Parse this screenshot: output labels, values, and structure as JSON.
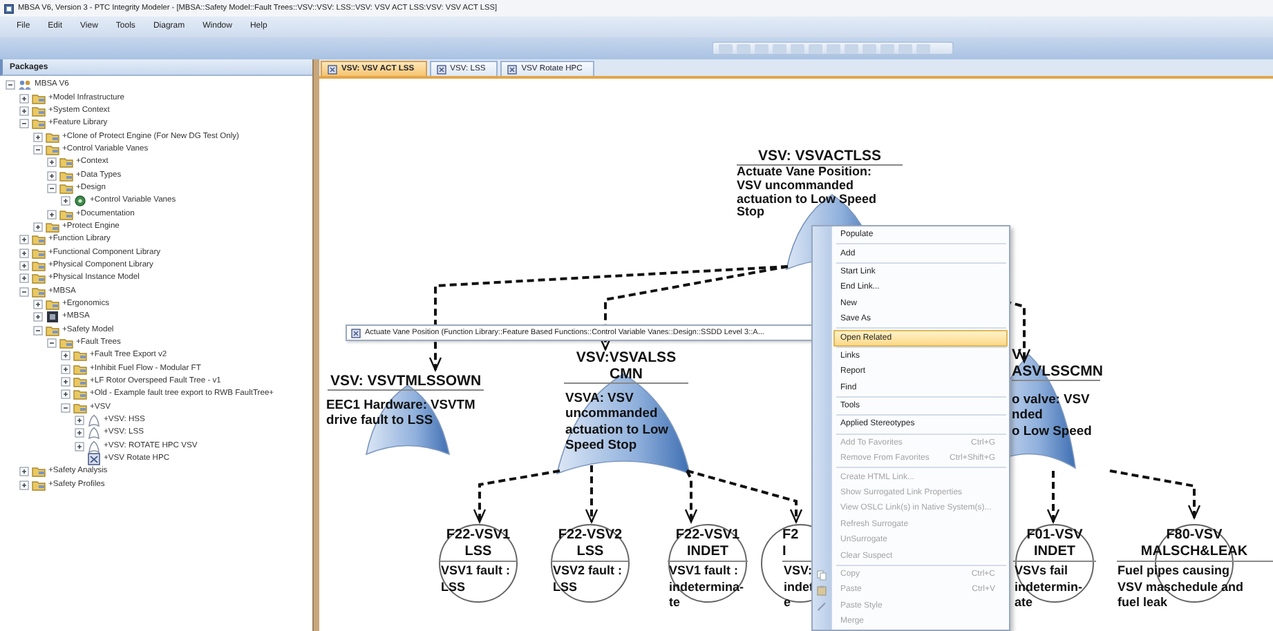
{
  "window": {
    "title": "MBSA V6, Version 3 - PTC Integrity Modeler - [MBSA::Safety Model::Fault Trees::VSV::VSV: LSS::VSV: VSV ACT LSS:VSV: VSV ACT LSS]"
  },
  "menu_bar": [
    "File",
    "Edit",
    "View",
    "Tools",
    "Diagram",
    "Window",
    "Help"
  ],
  "packages": {
    "title": "Packages",
    "tree": [
      {
        "label": "MBSA V6",
        "kind": "model",
        "expanded": true,
        "children": [
          {
            "label": "+Model Infrastructure",
            "kind": "package",
            "expanded": false
          },
          {
            "label": "+System Context",
            "kind": "package",
            "expanded": false
          },
          {
            "label": "+Feature Library",
            "kind": "package",
            "expanded": true,
            "children": [
              {
                "label": "+Clone of Protect Engine (For New DG Test Only)",
                "kind": "package",
                "expanded": false
              },
              {
                "label": "+Control Variable Vanes",
                "kind": "package",
                "expanded": true,
                "children": [
                  {
                    "label": "+Context",
                    "kind": "package",
                    "expanded": false
                  },
                  {
                    "label": "+Data Types",
                    "kind": "package",
                    "expanded": false
                  },
                  {
                    "label": "+Design",
                    "kind": "package",
                    "expanded": true,
                    "children": [
                      {
                        "label": "+Control Variable Vanes",
                        "kind": "component",
                        "expanded": false
                      }
                    ]
                  },
                  {
                    "label": "+Documentation",
                    "kind": "package",
                    "expanded": false
                  }
                ]
              },
              {
                "label": "+Protect Engine",
                "kind": "package",
                "expanded": false
              }
            ]
          },
          {
            "label": "+Function Library",
            "kind": "package",
            "expanded": false
          },
          {
            "label": "+Functional Component Library",
            "kind": "package",
            "expanded": false
          },
          {
            "label": "+Physical Component Library",
            "kind": "package",
            "expanded": false
          },
          {
            "label": "+Physical Instance Model",
            "kind": "package",
            "expanded": false
          },
          {
            "label": "+MBSA",
            "kind": "package",
            "expanded": true,
            "children": [
              {
                "label": "+Ergonomics",
                "kind": "package",
                "expanded": false
              },
              {
                "label": "+MBSA",
                "kind": "block",
                "expanded": false
              },
              {
                "label": "+Safety Model",
                "kind": "package",
                "expanded": true,
                "children": [
                  {
                    "label": "+Fault Trees",
                    "kind": "package",
                    "expanded": true,
                    "children": [
                      {
                        "label": "+Fault Tree Export v2",
                        "kind": "package",
                        "expanded": false
                      },
                      {
                        "label": "+Inhibit Fuel Flow - Modular FT",
                        "kind": "package",
                        "expanded": false
                      },
                      {
                        "label": "+LF Rotor Overspeed Fault Tree - v1",
                        "kind": "package",
                        "expanded": false
                      },
                      {
                        "label": "+Old - Example fault tree export to RWB FaultTree+",
                        "kind": "package",
                        "expanded": false
                      },
                      {
                        "label": "+VSV",
                        "kind": "package",
                        "expanded": true,
                        "children": [
                          {
                            "label": "+VSV: HSS",
                            "kind": "fault-tree",
                            "expanded": false
                          },
                          {
                            "label": "+VSV: LSS",
                            "kind": "fault-tree",
                            "expanded": false
                          },
                          {
                            "label": "+VSV: ROTATE HPC VSV",
                            "kind": "fault-tree",
                            "expanded": false
                          },
                          {
                            "label": "+VSV Rotate HPC",
                            "kind": "diagram"
                          }
                        ]
                      }
                    ]
                  }
                ]
              }
            ]
          },
          {
            "label": "+Safety Analysis",
            "kind": "package",
            "expanded": false
          },
          {
            "label": "+Safety Profiles",
            "kind": "package",
            "expanded": false
          }
        ]
      }
    ]
  },
  "tabs": [
    {
      "label": "VSV: VSV ACT LSS",
      "selected": true
    },
    {
      "label": "VSV: LSS",
      "selected": false
    },
    {
      "label": "VSV Rotate HPC",
      "selected": false
    }
  ],
  "diagram": {
    "gates": [
      {
        "title_lines": [
          "VSV: VSVACTLSS"
        ],
        "description_lines": [
          "Actuate Vane Position:",
          "VSV uncommanded",
          "actuation to Low Speed",
          "Stop"
        ]
      },
      {
        "title_lines": [
          "VSV: VSVTMLSSOWN"
        ],
        "description_lines": [
          "EEC1 Hardware: VSVTM",
          "drive fault to LSS"
        ]
      },
      {
        "title_lines": [
          "VSV:VSVALSS",
          "CMN"
        ],
        "description_lines": [
          "VSVA: VSV",
          "uncommanded",
          "actuation to Low",
          "Speed Stop"
        ]
      },
      {
        "title_lines": [
          "V",
          "ASVLSSCMN"
        ],
        "description_lines": [
          "o valve: VSV",
          "nded",
          "o Low Speed"
        ]
      }
    ],
    "events": [
      {
        "title_lines": [
          "F22-VSV1",
          "LSS"
        ],
        "description_lines": [
          "VSV1 fault :",
          "LSS"
        ]
      },
      {
        "title_lines": [
          "F22-VSV2",
          "LSS"
        ],
        "description_lines": [
          "VSV2 fault :",
          "LSS"
        ]
      },
      {
        "title_lines": [
          "F22-VSV1",
          "INDET"
        ],
        "description_lines": [
          "VSV1 fault :",
          "indetermina-",
          "te"
        ]
      },
      {
        "title_lines": [
          "F2",
          "I"
        ],
        "description_lines": [
          "VSV:",
          "indet",
          "e"
        ]
      },
      {
        "title_lines": [
          "F01-VSV",
          "INDET"
        ],
        "description_lines": [
          "VSVs fail",
          "indetermin-",
          "ate"
        ]
      },
      {
        "title_lines": [
          "F80-VSV",
          "MALSCH&LEAK"
        ],
        "description_lines": [
          "Fuel pipes causing",
          "VSV maschedule and",
          "fuel leak"
        ]
      }
    ],
    "tooltip": "Actuate Vane Position (Function Library::Feature Based Functions::Control Variable Vanes::Design::SSDD Level 3::A..."
  },
  "context_menu": {
    "groups": [
      [
        {
          "label": "Populate",
          "disabled": false,
          "selected": false
        }
      ],
      [
        {
          "label": "Add",
          "disabled": false,
          "selected": false
        }
      ],
      [
        {
          "label": "Start Link",
          "disabled": false,
          "selected": false
        },
        {
          "label": "End Link...",
          "disabled": false,
          "selected": false
        },
        {
          "label": "New",
          "disabled": false,
          "selected": false
        },
        {
          "label": "Save As",
          "disabled": false,
          "selected": false
        }
      ],
      [
        {
          "label": "Open Related",
          "disabled": false,
          "selected": true
        }
      ],
      [
        {
          "label": "Links",
          "disabled": false,
          "selected": false
        },
        {
          "label": "Report",
          "disabled": false,
          "selected": false
        },
        {
          "label": "Find",
          "disabled": false,
          "selected": false
        }
      ],
      [
        {
          "label": "Tools",
          "disabled": false,
          "selected": false
        }
      ],
      [
        {
          "label": "Applied Stereotypes",
          "disabled": false,
          "selected": false
        }
      ],
      [
        {
          "label": "Add To Favorites",
          "shortcut": "Ctrl+G",
          "disabled": true,
          "selected": false
        },
        {
          "label": "Remove From Favorites",
          "shortcut": "Ctrl+Shift+G",
          "disabled": true,
          "selected": false
        }
      ],
      [
        {
          "label": "Create HTML Link...",
          "disabled": true,
          "selected": false
        },
        {
          "label": "Show Surrogated Link Properties",
          "disabled": true,
          "selected": false
        },
        {
          "label": "View OSLC Link(s) in Native System(s)...",
          "disabled": true,
          "selected": false
        },
        {
          "label": "Refresh Surrogate",
          "disabled": true,
          "selected": false
        },
        {
          "label": "UnSurrogate",
          "disabled": true,
          "selected": false
        },
        {
          "label": "Clear Suspect",
          "disabled": true,
          "selected": false
        }
      ],
      [
        {
          "label": "Copy",
          "shortcut": "Ctrl+C",
          "disabled": true,
          "selected": false
        },
        {
          "label": "Paste",
          "shortcut": "Ctrl+V",
          "disabled": true,
          "selected": false
        },
        {
          "label": "Paste Style",
          "disabled": true,
          "selected": false
        },
        {
          "label": "Merge",
          "disabled": true,
          "selected": false
        }
      ]
    ]
  }
}
